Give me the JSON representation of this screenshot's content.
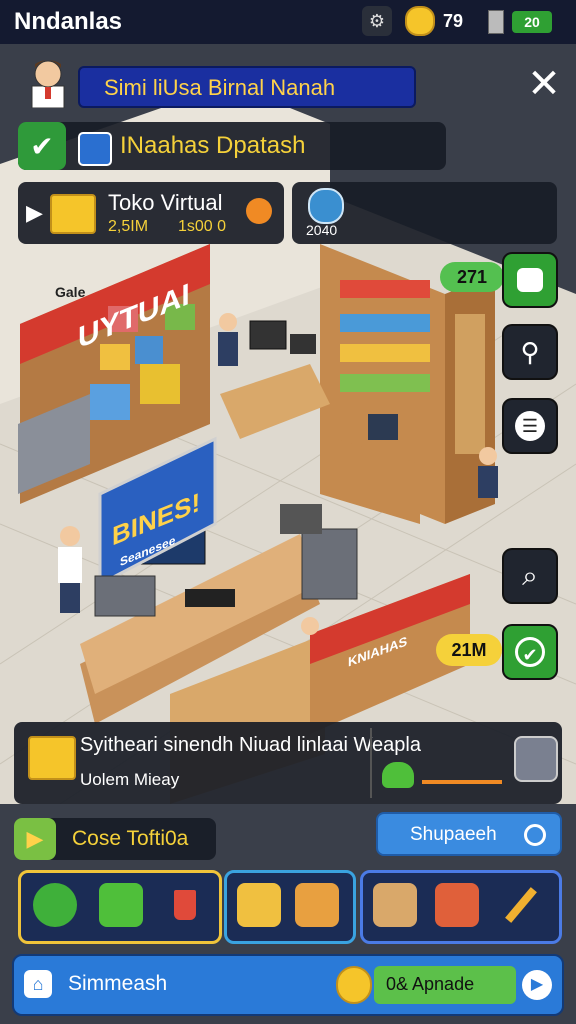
{
  "topbar": {
    "title": "Nndanlas",
    "icons": [
      "gear-icon",
      "coin-icon",
      "battery-icon"
    ],
    "coin_value": "79",
    "battery_value": "20"
  },
  "header": {
    "sim_banner": "Simi liUsa Birnal Nanah",
    "profile_label": "INaahas Dpatash",
    "toko_title": "Toko Virtual",
    "toko_sub_left": "2,5IM",
    "toko_sub_right": "1s00 0",
    "counter_value": "2040"
  },
  "scene": {
    "store_sign": "UYTUAI",
    "store_sign_small": "Gale",
    "business_sign": "BINES!",
    "business_sub": "Seanesee",
    "counter_sign": "KNIAHAS",
    "badge_top": "271",
    "badge_bottom": "21M"
  },
  "side_buttons": [
    "map-icon",
    "search-icon",
    "list-icon",
    "magnify-icon",
    "check-icon"
  ],
  "info_panel": {
    "title": "Syitheari sinendh Niuad linlaai Weapla",
    "subtitle": "Uolem Mieay"
  },
  "actions": {
    "left_label": "Cose Tofti0a",
    "right_label": "Shupaeeh"
  },
  "bottom_bar": {
    "left_label": "Simmeash",
    "upgrade_label": "0& Apnade"
  },
  "colors": {
    "accent_green": "#3cb043",
    "accent_blue": "#3a8be0",
    "accent_yellow": "#f5d13a",
    "dark_panel": "#181c26"
  }
}
